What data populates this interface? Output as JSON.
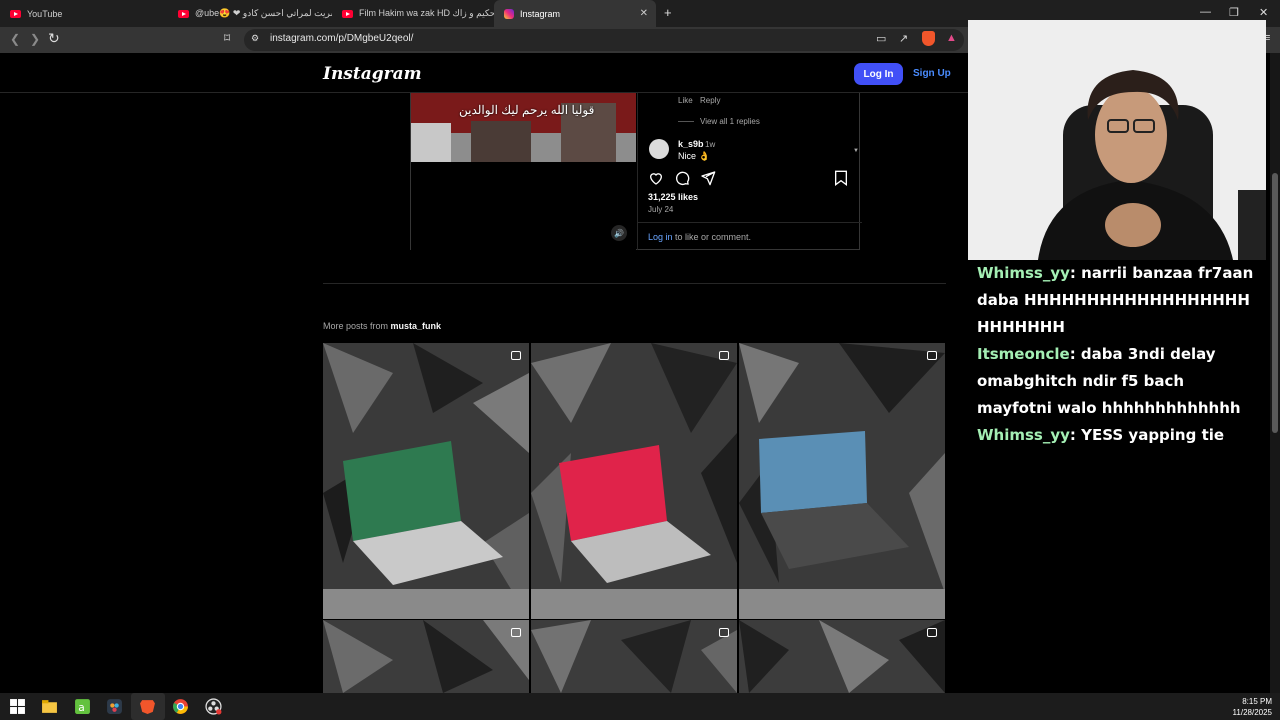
{
  "browser": {
    "tabs": [
      {
        "label": "YouTube",
        "icon": "youtube-icon"
      },
      {
        "label": "@ube😍 ❤ شريت لمراتي احسن كادو",
        "icon": "youtube-icon"
      },
      {
        "label": "Film Hakim wa zak HD فيلم حكيم و زاك",
        "icon": "youtube-icon"
      },
      {
        "label": "Instagram",
        "icon": "instagram-icon"
      }
    ],
    "url": "instagram.com/p/DMgbeU2qeol/"
  },
  "instagram": {
    "logo": "Instagram",
    "login_label": "Log In",
    "signup_label": "Sign Up",
    "subtitle": "قوليا الله يرحم ليك الوالدين",
    "comment_actions": {
      "like": "Like",
      "reply": "Reply",
      "view_replies": "View all 1 replies"
    },
    "comment": {
      "user": "k_s9b",
      "age": "1w",
      "text": "Nice 👌"
    },
    "likes": "31,225 likes",
    "date": "July 24",
    "login_link": "Log in",
    "login_suffix": " to like or comment.",
    "more_posts_prefix": "More posts from ",
    "more_posts_user": "musta_funk",
    "thumb_screens": [
      "#2e7a50",
      "#e0234a",
      "#5a8fb5"
    ]
  },
  "chat": {
    "messages": [
      {
        "user": "Whimss_yy",
        "text": "narrii banzaa fr7aan daba HHHHHHHHHHHHHHHHHHHHHHHHH"
      },
      {
        "user": "Itsmeoncle",
        "text": "daba 3ndi delay omabghitch ndir f5 bach mayfotni walo hhhhhhhhhhhhh"
      },
      {
        "user": "Whimss_yy",
        "text": "YESS yapping tie"
      }
    ]
  },
  "taskbar": {
    "time": "8:15 PM",
    "date": "11/28/2025"
  }
}
